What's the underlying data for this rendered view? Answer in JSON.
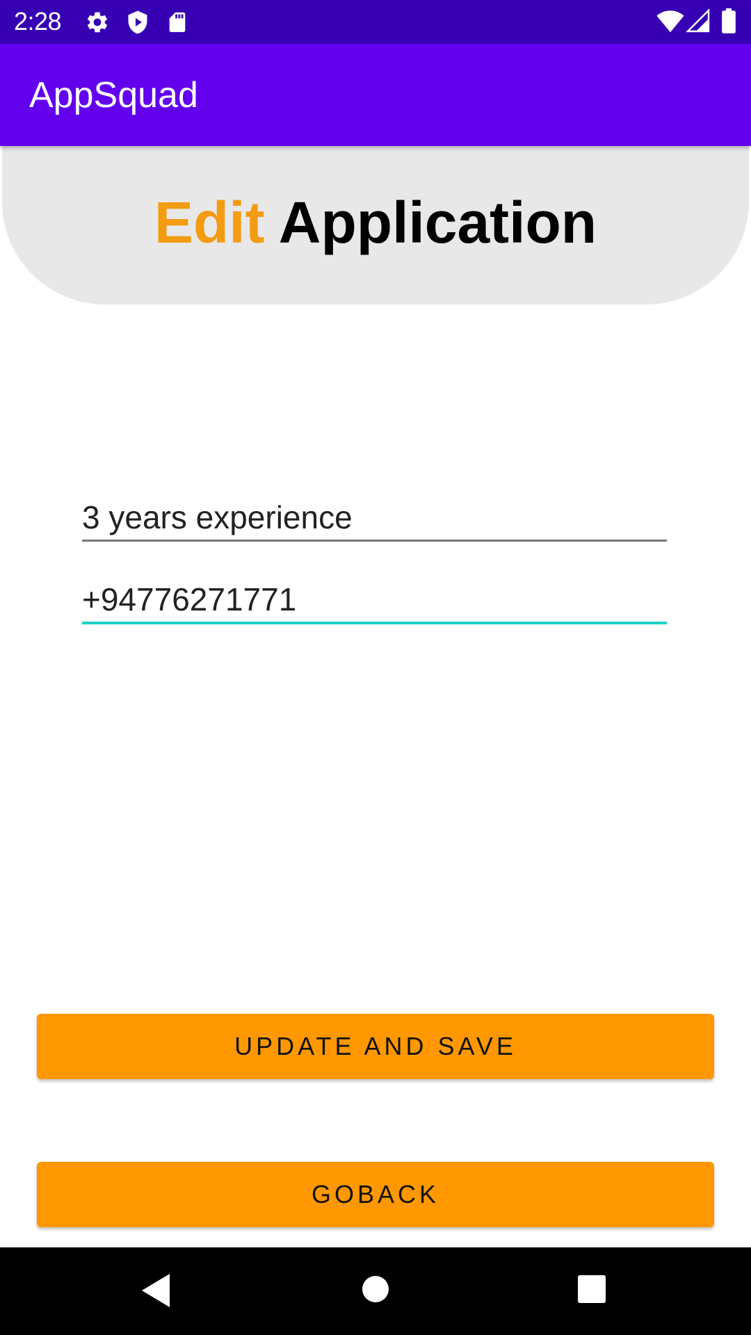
{
  "status_bar": {
    "time": "2:28",
    "left_icons": [
      "settings-icon",
      "shield-play-icon",
      "sd-card-icon"
    ],
    "right_icons": [
      "wifi-icon",
      "cell-signal-icon",
      "battery-icon"
    ],
    "background": "#3700b3"
  },
  "app_bar": {
    "title": "AppSquad",
    "background": "#6200ee"
  },
  "header": {
    "title_accent": "Edit",
    "title_rest": "Application",
    "accent_color": "#f39c12"
  },
  "form": {
    "experience_value": "3 years experience",
    "phone_value": "+94776271771",
    "focus_color": "#1ad1c7"
  },
  "buttons": {
    "update_label": "UPDATE AND SAVE",
    "goback_label": "GOBACK",
    "color": "#ff9800"
  },
  "nav_bar": {
    "icons": [
      "back-icon",
      "home-icon",
      "recents-icon"
    ]
  }
}
